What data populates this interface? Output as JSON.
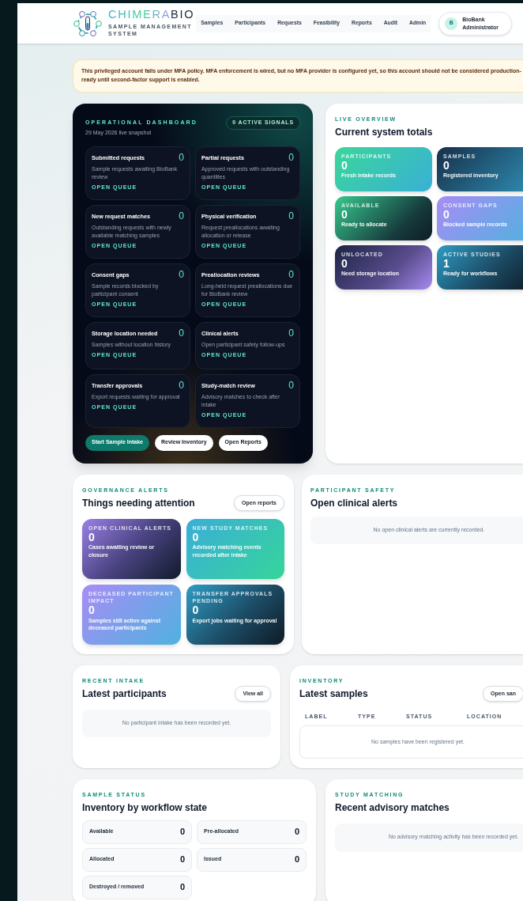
{
  "brand": {
    "name_main": "CHIMERA",
    "name_accent": "BIO",
    "subtitle": "SAMPLE MANAGEMENT SYSTEM"
  },
  "nav": [
    "Samples",
    "Participants",
    "Requests",
    "Feasibility",
    "Reports",
    "Audit",
    "Admin"
  ],
  "user": {
    "avatar": "B",
    "name": "BioBank Administrator"
  },
  "banner": "This privileged account falls under MFA policy. MFA enforcement is wired, but no MFA provider is configured yet, so this account should not be considered production-ready until second-factor support is enabled.",
  "dashboard": {
    "eyebrow": "OPERATIONAL DASHBOARD",
    "date": "29 May 2026 live snapshot",
    "signals": "0 ACTIVE SIGNALS",
    "queues": [
      {
        "title": "Submitted requests",
        "count": "0",
        "description": "Sample requests awaiting BioBank review",
        "link": "OPEN QUEUE"
      },
      {
        "title": "Partial requests",
        "count": "0",
        "description": "Approved requests with outstanding quantities",
        "link": "OPEN QUEUE"
      },
      {
        "title": "New request matches",
        "count": "0",
        "description": "Outstanding requests with newly available matching samples",
        "link": "OPEN QUEUE"
      },
      {
        "title": "Physical verification",
        "count": "0",
        "description": "Request preallocations awaiting allocation or release",
        "link": "OPEN QUEUE"
      },
      {
        "title": "Consent gaps",
        "count": "0",
        "description": "Sample records blocked by participant consent",
        "link": "OPEN QUEUE"
      },
      {
        "title": "Preallocation reviews",
        "count": "0",
        "description": "Long-held request preallocations due for BioBank review",
        "link": "OPEN QUEUE"
      },
      {
        "title": "Storage location needed",
        "count": "0",
        "description": "Samples without location history",
        "link": "OPEN QUEUE"
      },
      {
        "title": "Clinical alerts",
        "count": "0",
        "description": "Open participant safety follow-ups",
        "link": "OPEN QUEUE"
      },
      {
        "title": "Transfer approvals",
        "count": "0",
        "description": "Export requests waiting for approval",
        "link": "OPEN QUEUE"
      },
      {
        "title": "Study-match review",
        "count": "0",
        "description": "Advisory matches to check after intake",
        "link": "OPEN QUEUE"
      }
    ],
    "actions": [
      {
        "label": "Start Sample Intake",
        "kind": "primary"
      },
      {
        "label": "Review Inventory",
        "kind": "secondary"
      },
      {
        "label": "Open Reports",
        "kind": "secondary"
      }
    ]
  },
  "overview": {
    "eyebrow": "LIVE OVERVIEW",
    "title": "Current system totals",
    "tiles": [
      {
        "label": "PARTICIPANTS",
        "value": "0",
        "caption": "Fresh intake records",
        "kind": "aqua"
      },
      {
        "label": "SAMPLES",
        "value": "0",
        "caption": "Registered inventory",
        "kind": "ocean"
      },
      {
        "label": "AVAILABLE",
        "value": "0",
        "caption": "Ready to allocate",
        "kind": "forest"
      },
      {
        "label": "CONSENT GAPS",
        "value": "0",
        "caption": "Blocked sample records",
        "kind": "iris"
      },
      {
        "label": "UNLOCATED",
        "value": "0",
        "caption": "Need storage location",
        "kind": "dusk"
      },
      {
        "label": "ACTIVE STUDIES",
        "value": "1",
        "caption": "Ready for workflows",
        "kind": "lagoon"
      }
    ]
  },
  "governance": {
    "eyebrow": "GOVERNANCE ALERTS",
    "title": "Things needing attention",
    "button": "Open reports",
    "tiles": [
      {
        "label": "OPEN CLINICAL ALERTS",
        "value": "0",
        "caption": "Cases awaiting review or closure",
        "kind": "plum"
      },
      {
        "label": "NEW STUDY MATCHES",
        "value": "0",
        "caption": "Advisory matching events recorded after intake",
        "kind": "seafoam"
      },
      {
        "label": "DECEASED PARTICIPANT IMPACT",
        "value": "0",
        "caption": "Samples still active against deceased participants",
        "kind": "iris"
      },
      {
        "label": "TRANSFER APPROVALS PENDING",
        "value": "0",
        "caption": "Export jobs waiting for approval",
        "kind": "lagoon"
      }
    ]
  },
  "safety": {
    "eyebrow": "PARTICIPANT SAFETY",
    "title": "Open clinical alerts",
    "empty": "No open clinical alerts are currently recorded."
  },
  "intake": {
    "eyebrow": "RECENT INTAKE",
    "title": "Latest participants",
    "button": "View all",
    "empty": "No participant intake has been recorded yet."
  },
  "inventory": {
    "eyebrow": "INVENTORY",
    "title": "Latest samples",
    "button": "Open san",
    "columns": [
      "LABEL",
      "TYPE",
      "STATUS",
      "LOCATION"
    ],
    "empty": "No samples have been registered yet."
  },
  "sample_status": {
    "eyebrow": "SAMPLE STATUS",
    "title": "Inventory by workflow state",
    "states": [
      {
        "label": "Available",
        "count": "0"
      },
      {
        "label": "Pre-allocated",
        "count": "0"
      },
      {
        "label": "Allocated",
        "count": "0"
      },
      {
        "label": "Issued",
        "count": "0"
      },
      {
        "label": "Destroyed / removed",
        "count": "0"
      }
    ]
  },
  "study_matching": {
    "eyebrow": "STUDY MATCHING",
    "title": "Recent advisory matches",
    "empty": "No advisory matching activity has been recorded yet."
  }
}
